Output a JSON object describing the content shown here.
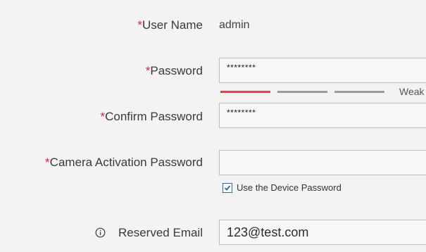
{
  "form": {
    "username": {
      "required_mark": "*",
      "label": "User Name",
      "value": "admin"
    },
    "password": {
      "required_mark": "*",
      "label": "Password",
      "value": "********",
      "strength_label": "Weak",
      "strength_colors": [
        "#e8414a",
        "#9a9a9a",
        "#9a9a9a"
      ]
    },
    "confirm_password": {
      "required_mark": "*",
      "label": "Confirm Password",
      "value": "********"
    },
    "camera_activation_password": {
      "required_mark": "*",
      "label": "Camera Activation Password",
      "value": "",
      "use_device_password_checked": true,
      "use_device_password_label": "Use the Device Password"
    },
    "reserved_email": {
      "icon": "info-icon",
      "label": "Reserved Email",
      "value": "123@test.com"
    }
  },
  "colors": {
    "required": "#d9242b",
    "checkbox_accent": "#2f66b8"
  }
}
